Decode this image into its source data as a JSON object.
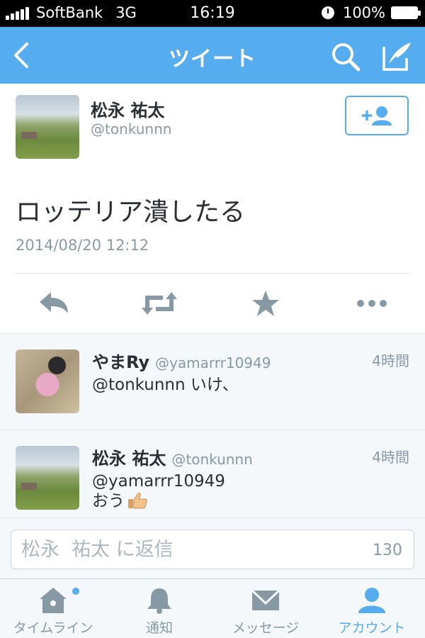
{
  "status_bar": {
    "carrier": "SoftBank",
    "network": "3G",
    "time": "16:19",
    "battery": "100%"
  },
  "nav": {
    "title": "ツイート",
    "back_icon": "chevron-left-icon",
    "search_icon": "search-icon",
    "compose_icon": "compose-icon"
  },
  "main_tweet": {
    "name": "松永  祐太",
    "handle": "@tonkunnn",
    "text": "ロッテリア潰したる",
    "date": "2014/08/20 12:12",
    "follow_icon": "add-user-icon",
    "actions": [
      "reply-icon",
      "retweet-icon",
      "favorite-star-icon",
      "more-icon"
    ]
  },
  "replies": [
    {
      "name": "やまRy",
      "handle": "@yamarrr10949",
      "time": "4時間",
      "text": "@tonkunnn いけ、"
    },
    {
      "name": "松永  祐太",
      "handle": "@tonkunnn",
      "time": "4時間",
      "text_line1": "@yamarrr10949",
      "text_line2": "おう",
      "emoji": "thumbs-up-icon"
    }
  ],
  "composer": {
    "placeholder": "松永  祐太 に返信",
    "count": "130"
  },
  "tabs": [
    {
      "label": "タイムライン",
      "icon": "home-icon"
    },
    {
      "label": "通知",
      "icon": "bell-icon"
    },
    {
      "label": "メッセージ",
      "icon": "envelope-icon"
    },
    {
      "label": "アカウント",
      "icon": "person-icon"
    }
  ],
  "colors": {
    "brand": "#55acee",
    "text": "#292f33",
    "secondary": "#8899a6"
  }
}
